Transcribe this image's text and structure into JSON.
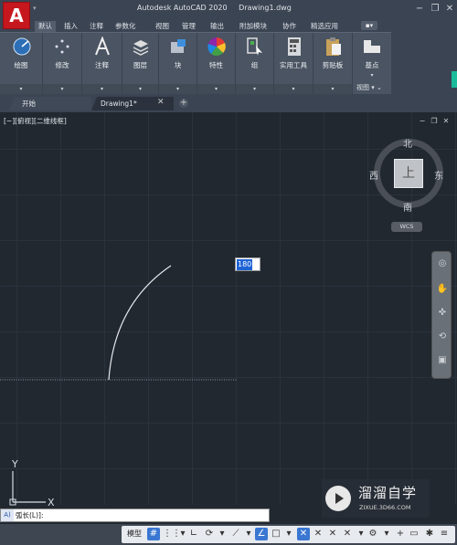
{
  "app": {
    "logo_letter": "A",
    "title": "Autodesk AutoCAD 2020",
    "filename": "Drawing1.dwg"
  },
  "ribbon_tabs": [
    {
      "label": "默认",
      "active": true
    },
    {
      "label": "插入"
    },
    {
      "label": "注释"
    },
    {
      "label": "参数化"
    },
    {
      "label": "视图"
    },
    {
      "label": "管理"
    },
    {
      "label": "输出"
    },
    {
      "label": "附加模块"
    },
    {
      "label": "协作"
    },
    {
      "label": "精选应用"
    }
  ],
  "ribbon_groups": [
    {
      "label": "绘图",
      "icon": "draw-circle-icon"
    },
    {
      "label": "修改",
      "icon": "move-icon"
    },
    {
      "label": "注释",
      "icon": "text-A-icon"
    },
    {
      "label": "图层",
      "icon": "layers-icon"
    },
    {
      "label": "块",
      "icon": "insert-block-icon"
    },
    {
      "label": "特性",
      "icon": "color-wheel-icon"
    },
    {
      "label": "组",
      "icon": "group-icon"
    },
    {
      "label": "实用工具",
      "icon": "calculator-icon"
    },
    {
      "label": "剪贴板",
      "icon": "clipboard-icon"
    },
    {
      "label": "基点",
      "icon": "base-point-icon"
    }
  ],
  "view_panel_title": "视图",
  "doc_tabs": {
    "start": "开始",
    "drawing": "Drawing1*"
  },
  "viewport": {
    "label": "[−][俯视][二维线框]",
    "viewcube": {
      "top": "上",
      "north": "北",
      "south": "南",
      "east": "东",
      "west": "西"
    },
    "wcs": "WCS",
    "dynamic_input_value": "180"
  },
  "ucs": {
    "x": "X",
    "y": "Y"
  },
  "watermark": {
    "title": "溜溜自学",
    "subtitle": "ZIXUE.3D66.COM"
  },
  "command_line": {
    "prefix": "A)",
    "text": "弧长(L)]:"
  },
  "statusbar": {
    "model_label": "模型"
  },
  "colors": {
    "accent": "#3a77d2",
    "logo_red": "#c6171e",
    "viewport_bg": "#212830",
    "arc": "#e6e9ee"
  }
}
